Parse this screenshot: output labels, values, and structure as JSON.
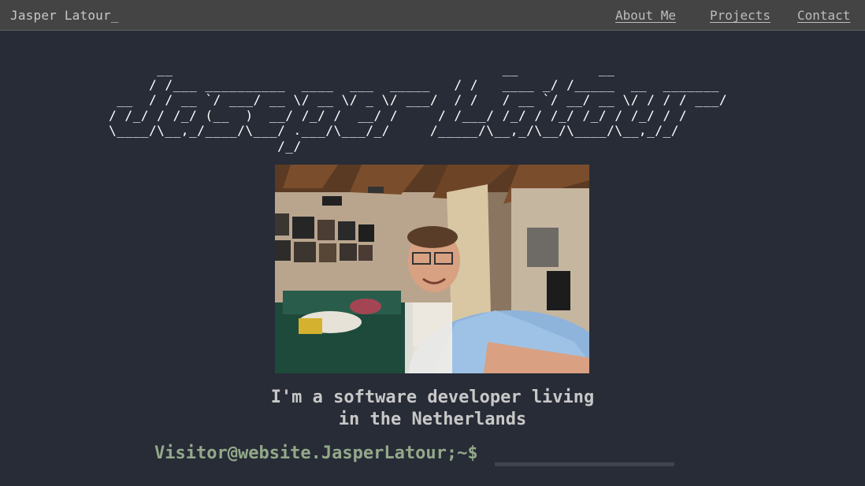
{
  "nav": {
    "brand": "Jasper Latour_",
    "links": [
      {
        "label": "About Me"
      },
      {
        "label": "Projects"
      },
      {
        "label": "Contact"
      }
    ]
  },
  "hero": {
    "ascii_banner": "      __                                         __          __\n     / /___ __________  ____  ___  _____   / /   ____ _/ /_____  __  _______\n __  / / __ `/ ___/ __ \\/ __ \\/ _ \\/ ___/  / /   / __ `/ __/ __ \\/ / / / ___/\n/ /_/ / /_/ (__  )  __/ /_/ /  __/ /     / /___/ /_/ / /_/ /_/ / /_/ / /\n\\____/\\__,_/____/\\___/ .___/\\___/_/     /_____/\\__,_/\\__/\\____/\\__,_/_/\n                     /_/",
    "photo_alt": "Selfie of Jasper in a room with posters on the wall"
  },
  "tagline": {
    "line1": "I'm a software developer living",
    "line2": "in the Netherlands"
  },
  "terminal": {
    "prompt": "Visitor@website.JasperLatour;~$",
    "input_value": ""
  }
}
